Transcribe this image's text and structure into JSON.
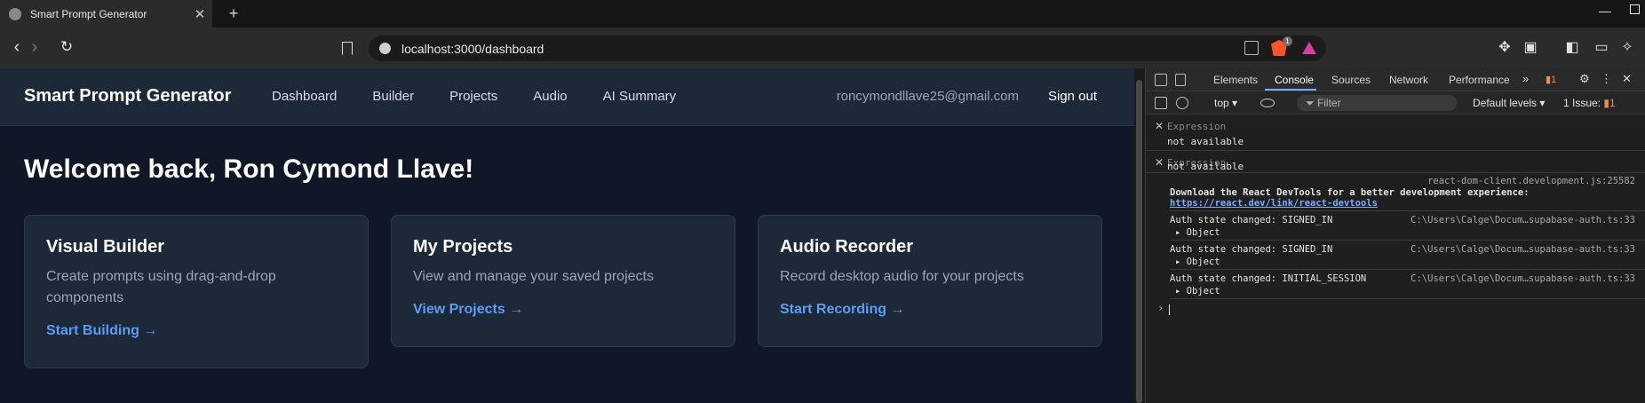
{
  "browser": {
    "tab_title": "Smart Prompt Generator",
    "tab_close": "✕",
    "new_tab": "+",
    "url": "localhost:3000/dashboard",
    "extension_badge": "1"
  },
  "app": {
    "brand": "Smart Prompt Generator",
    "nav": [
      "Dashboard",
      "Builder",
      "Projects",
      "Audio",
      "AI Summary"
    ],
    "user_email": "roncymondllave25@gmail.com",
    "sign_out": "Sign out",
    "welcome": "Welcome back, Ron Cymond Llave!",
    "cards": [
      {
        "title": "Visual Builder",
        "description": "Create prompts using drag-and-drop components",
        "link": "Start Building →"
      },
      {
        "title": "My Projects",
        "description": "View and manage your saved projects",
        "link": "View Projects →"
      },
      {
        "title": "Audio Recorder",
        "description": "Record desktop audio for your projects",
        "link": "Start Recording →"
      }
    ]
  },
  "devtools": {
    "tabs": [
      "Elements",
      "Console",
      "Sources",
      "Network",
      "Performance"
    ],
    "active_tab": "Console",
    "more": "»",
    "error_badge": "1",
    "context": "top ▾",
    "filter_placeholder": "Filter",
    "levels": "Default levels ▾",
    "issues": "1 Issue:",
    "issues_count": "1",
    "live_expressions": [
      {
        "label": "Expression",
        "value": "not available"
      },
      {
        "label": "Expression",
        "value": "not available"
      }
    ],
    "logs": {
      "devtools_src": "react-dom-client.development.js:25582",
      "devtools_msg": "Download the React DevTools for a better development experience:",
      "devtools_link": "https://react.dev/link/react-devtools",
      "entries": [
        {
          "msg": "Auth state changed: SIGNED_IN",
          "src": "C:\\Users\\Calge\\Docum…supabase-auth.ts:33",
          "obj": "▸ Object"
        },
        {
          "msg": "Auth state changed: SIGNED_IN",
          "src": "C:\\Users\\Calge\\Docum…supabase-auth.ts:33",
          "obj": "▸ Object"
        },
        {
          "msg": "Auth state changed: INITIAL_SESSION",
          "src": "C:\\Users\\Calge\\Docum…supabase-auth.ts:33",
          "obj": "▸ Object"
        }
      ],
      "prompt": "›"
    }
  },
  "colors": {
    "page_bg": "#101828",
    "header_bg": "#1d2838",
    "link_blue": "#5b9cf5"
  }
}
